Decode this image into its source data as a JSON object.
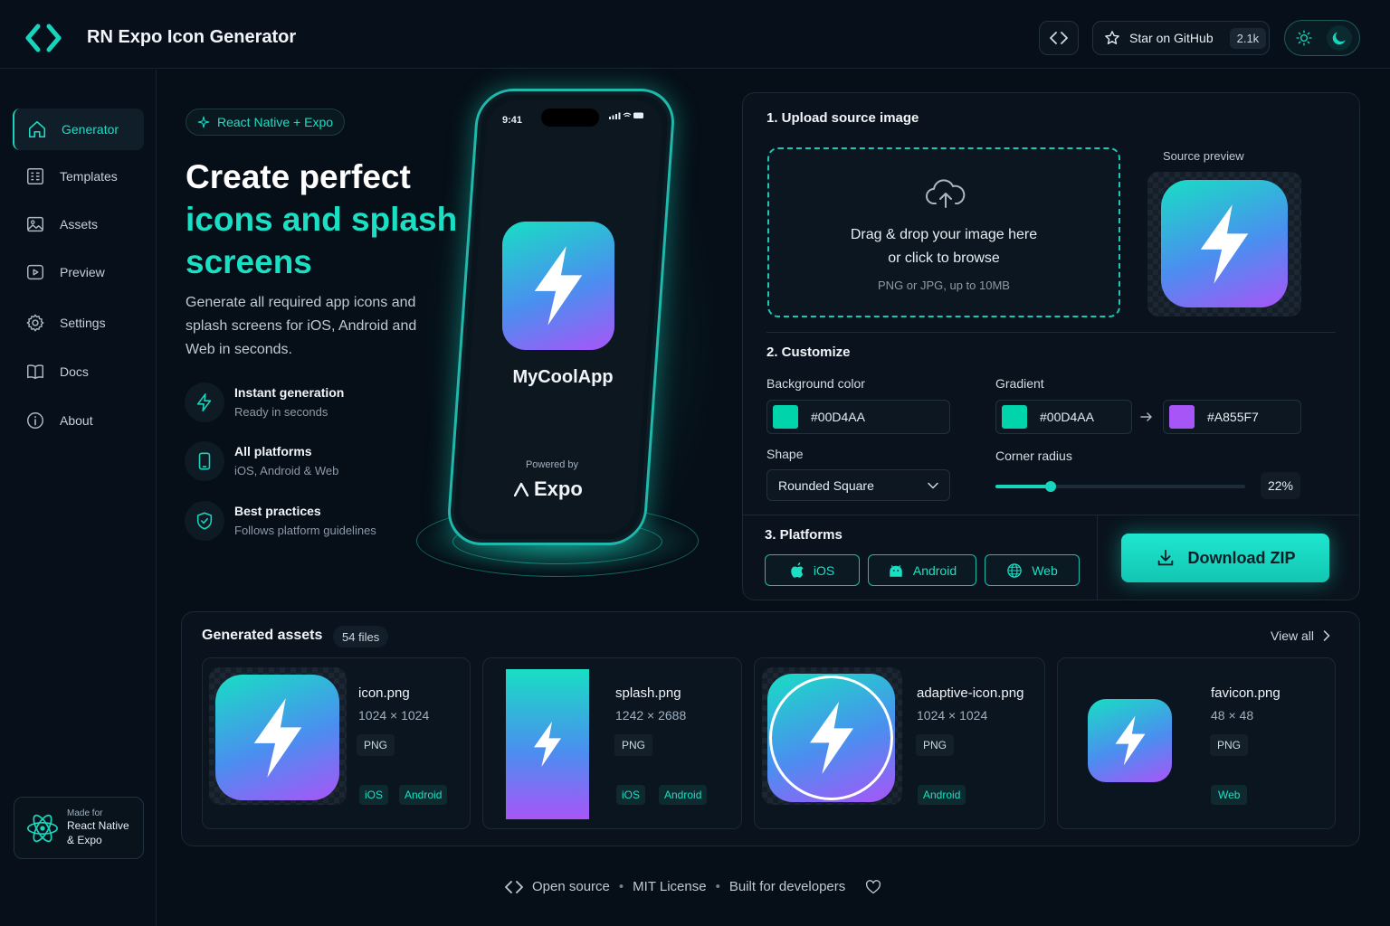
{
  "header": {
    "title": "RN Expo Icon Generator",
    "github_label": "Star on GitHub",
    "github_count": "2.1k"
  },
  "sidebar": {
    "items": [
      {
        "label": "Generator",
        "icon": "home-icon",
        "active": true
      },
      {
        "label": "Templates",
        "icon": "templates-icon"
      },
      {
        "label": "Assets",
        "icon": "image-icon"
      },
      {
        "label": "Preview",
        "icon": "play-icon"
      },
      {
        "label": "Settings",
        "icon": "gear-icon"
      },
      {
        "label": "Docs",
        "icon": "book-icon"
      },
      {
        "label": "About",
        "icon": "info-icon"
      }
    ],
    "made_for": {
      "small": "Made for",
      "line1": "React Native",
      "line2": "& Expo"
    }
  },
  "hero": {
    "badge": "React Native + Expo",
    "title_line1": "Create perfect",
    "title_line2": "icons and splash",
    "title_line3": "screens",
    "description": "Generate all required app icons and splash screens for iOS, Android and Web in seconds.",
    "features": [
      {
        "title": "Instant generation",
        "subtitle": "Ready in seconds",
        "icon": "bolt-icon"
      },
      {
        "title": "All platforms",
        "subtitle": "iOS, Android & Web",
        "icon": "phone-icon"
      },
      {
        "title": "Best practices",
        "subtitle": "Follows platform guidelines",
        "icon": "shield-check-icon"
      }
    ]
  },
  "phone": {
    "time": "9:41",
    "app_name": "MyCoolApp",
    "powered_by": "Powered by",
    "brand": "Expo"
  },
  "upload": {
    "section_title": "1. Upload source image",
    "drop_line1": "Drag & drop your image here",
    "drop_line2": "or click to browse",
    "drop_hint": "PNG or JPG, up to 10MB",
    "preview_label": "Source preview"
  },
  "customize": {
    "section_title": "2. Customize",
    "bg_label": "Background color",
    "bg_value": "#00D4AA",
    "gradient_label": "Gradient",
    "gradient_from": "#00D4AA",
    "gradient_to": "#A855F7",
    "shape_label": "Shape",
    "shape_value": "Rounded Square",
    "radius_label": "Corner radius",
    "radius_value": "22%",
    "radius_fraction": 0.22
  },
  "platforms": {
    "section_title": "3. Platforms",
    "buttons": [
      {
        "label": "iOS",
        "icon": "apple-icon"
      },
      {
        "label": "Android",
        "icon": "android-icon"
      },
      {
        "label": "Web",
        "icon": "globe-icon"
      }
    ],
    "download_label": "Download ZIP"
  },
  "assets": {
    "title": "Generated assets",
    "count": "54 files",
    "view_all": "View all",
    "cards": [
      {
        "name": "icon.png",
        "dims": "1024 × 1024",
        "format": "PNG",
        "tags": [
          "iOS",
          "Android"
        ]
      },
      {
        "name": "splash.png",
        "dims": "1242 × 2688",
        "format": "PNG",
        "tags": [
          "iOS",
          "Android"
        ]
      },
      {
        "name": "adaptive-icon.png",
        "dims": "1024 × 1024",
        "format": "PNG",
        "tags": [
          "Android"
        ]
      },
      {
        "name": "favicon.png",
        "dims": "48 × 48",
        "format": "PNG",
        "tags": [
          "Web"
        ]
      }
    ]
  },
  "footer": {
    "open_source": "Open source",
    "license": "MIT License",
    "built_for": "Built for developers"
  },
  "colors": {
    "accent": "#19D4BC",
    "gradient_start": "#00D4AA",
    "gradient_end": "#A855F7",
    "background": "#060E17"
  }
}
